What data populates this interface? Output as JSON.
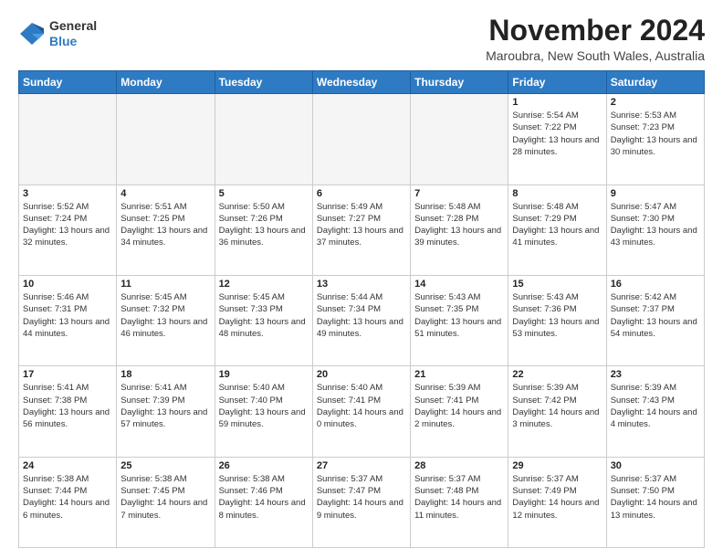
{
  "logo": {
    "general": "General",
    "blue": "Blue"
  },
  "header": {
    "month": "November 2024",
    "location": "Maroubra, New South Wales, Australia"
  },
  "weekdays": [
    "Sunday",
    "Monday",
    "Tuesday",
    "Wednesday",
    "Thursday",
    "Friday",
    "Saturday"
  ],
  "weeks": [
    [
      {
        "day": "",
        "info": ""
      },
      {
        "day": "",
        "info": ""
      },
      {
        "day": "",
        "info": ""
      },
      {
        "day": "",
        "info": ""
      },
      {
        "day": "",
        "info": ""
      },
      {
        "day": "1",
        "info": "Sunrise: 5:54 AM\nSunset: 7:22 PM\nDaylight: 13 hours\nand 28 minutes."
      },
      {
        "day": "2",
        "info": "Sunrise: 5:53 AM\nSunset: 7:23 PM\nDaylight: 13 hours\nand 30 minutes."
      }
    ],
    [
      {
        "day": "3",
        "info": "Sunrise: 5:52 AM\nSunset: 7:24 PM\nDaylight: 13 hours\nand 32 minutes."
      },
      {
        "day": "4",
        "info": "Sunrise: 5:51 AM\nSunset: 7:25 PM\nDaylight: 13 hours\nand 34 minutes."
      },
      {
        "day": "5",
        "info": "Sunrise: 5:50 AM\nSunset: 7:26 PM\nDaylight: 13 hours\nand 36 minutes."
      },
      {
        "day": "6",
        "info": "Sunrise: 5:49 AM\nSunset: 7:27 PM\nDaylight: 13 hours\nand 37 minutes."
      },
      {
        "day": "7",
        "info": "Sunrise: 5:48 AM\nSunset: 7:28 PM\nDaylight: 13 hours\nand 39 minutes."
      },
      {
        "day": "8",
        "info": "Sunrise: 5:48 AM\nSunset: 7:29 PM\nDaylight: 13 hours\nand 41 minutes."
      },
      {
        "day": "9",
        "info": "Sunrise: 5:47 AM\nSunset: 7:30 PM\nDaylight: 13 hours\nand 43 minutes."
      }
    ],
    [
      {
        "day": "10",
        "info": "Sunrise: 5:46 AM\nSunset: 7:31 PM\nDaylight: 13 hours\nand 44 minutes."
      },
      {
        "day": "11",
        "info": "Sunrise: 5:45 AM\nSunset: 7:32 PM\nDaylight: 13 hours\nand 46 minutes."
      },
      {
        "day": "12",
        "info": "Sunrise: 5:45 AM\nSunset: 7:33 PM\nDaylight: 13 hours\nand 48 minutes."
      },
      {
        "day": "13",
        "info": "Sunrise: 5:44 AM\nSunset: 7:34 PM\nDaylight: 13 hours\nand 49 minutes."
      },
      {
        "day": "14",
        "info": "Sunrise: 5:43 AM\nSunset: 7:35 PM\nDaylight: 13 hours\nand 51 minutes."
      },
      {
        "day": "15",
        "info": "Sunrise: 5:43 AM\nSunset: 7:36 PM\nDaylight: 13 hours\nand 53 minutes."
      },
      {
        "day": "16",
        "info": "Sunrise: 5:42 AM\nSunset: 7:37 PM\nDaylight: 13 hours\nand 54 minutes."
      }
    ],
    [
      {
        "day": "17",
        "info": "Sunrise: 5:41 AM\nSunset: 7:38 PM\nDaylight: 13 hours\nand 56 minutes."
      },
      {
        "day": "18",
        "info": "Sunrise: 5:41 AM\nSunset: 7:39 PM\nDaylight: 13 hours\nand 57 minutes."
      },
      {
        "day": "19",
        "info": "Sunrise: 5:40 AM\nSunset: 7:40 PM\nDaylight: 13 hours\nand 59 minutes."
      },
      {
        "day": "20",
        "info": "Sunrise: 5:40 AM\nSunset: 7:41 PM\nDaylight: 14 hours\nand 0 minutes."
      },
      {
        "day": "21",
        "info": "Sunrise: 5:39 AM\nSunset: 7:41 PM\nDaylight: 14 hours\nand 2 minutes."
      },
      {
        "day": "22",
        "info": "Sunrise: 5:39 AM\nSunset: 7:42 PM\nDaylight: 14 hours\nand 3 minutes."
      },
      {
        "day": "23",
        "info": "Sunrise: 5:39 AM\nSunset: 7:43 PM\nDaylight: 14 hours\nand 4 minutes."
      }
    ],
    [
      {
        "day": "24",
        "info": "Sunrise: 5:38 AM\nSunset: 7:44 PM\nDaylight: 14 hours\nand 6 minutes."
      },
      {
        "day": "25",
        "info": "Sunrise: 5:38 AM\nSunset: 7:45 PM\nDaylight: 14 hours\nand 7 minutes."
      },
      {
        "day": "26",
        "info": "Sunrise: 5:38 AM\nSunset: 7:46 PM\nDaylight: 14 hours\nand 8 minutes."
      },
      {
        "day": "27",
        "info": "Sunrise: 5:37 AM\nSunset: 7:47 PM\nDaylight: 14 hours\nand 9 minutes."
      },
      {
        "day": "28",
        "info": "Sunrise: 5:37 AM\nSunset: 7:48 PM\nDaylight: 14 hours\nand 11 minutes."
      },
      {
        "day": "29",
        "info": "Sunrise: 5:37 AM\nSunset: 7:49 PM\nDaylight: 14 hours\nand 12 minutes."
      },
      {
        "day": "30",
        "info": "Sunrise: 5:37 AM\nSunset: 7:50 PM\nDaylight: 14 hours\nand 13 minutes."
      }
    ]
  ]
}
